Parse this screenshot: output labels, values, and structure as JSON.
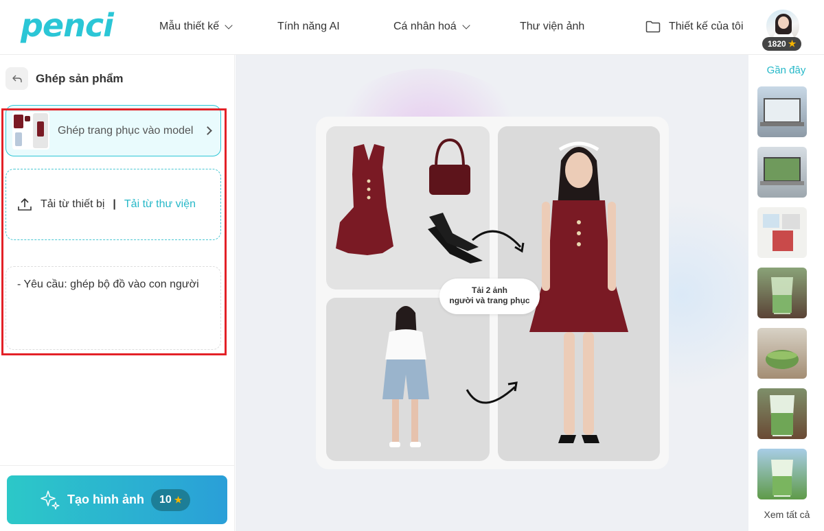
{
  "header": {
    "logo": "penci",
    "nav": [
      {
        "label": "Mẫu thiết kế",
        "has_dropdown": true
      },
      {
        "label": "Tính năng AI",
        "has_dropdown": false
      },
      {
        "label": "Cá nhân hoá",
        "has_dropdown": true
      },
      {
        "label": "Thư viện ảnh",
        "has_dropdown": false
      }
    ],
    "my_designs": "Thiết kế của tôi",
    "points": "1820"
  },
  "sidebar": {
    "title": "Ghép sản phẩm",
    "product_card_label": "Ghép trang phục vào model",
    "upload_device": "Tải từ thiết bị",
    "upload_separator": "|",
    "upload_library": "Tải từ thư viện",
    "prompt_text": "- Yêu cầu: ghép bộ đồ vào con người",
    "generate_label": "Tạo hình ảnh",
    "generate_cost": "10"
  },
  "preview": {
    "callout_line1": "Tải 2 ảnh",
    "callout_line2": "người và trang phục"
  },
  "recent": {
    "title": "Gần đây",
    "see_all": "Xem tất cả",
    "items": [
      "laptop-mockup",
      "laptop-landscape",
      "photo-collage",
      "matcha-drink",
      "matcha-bowl",
      "matcha-latte",
      "matcha-field"
    ]
  },
  "colors": {
    "brand": "#2bc6d6",
    "highlight": "#e32127",
    "garment": "#7a1a24"
  }
}
